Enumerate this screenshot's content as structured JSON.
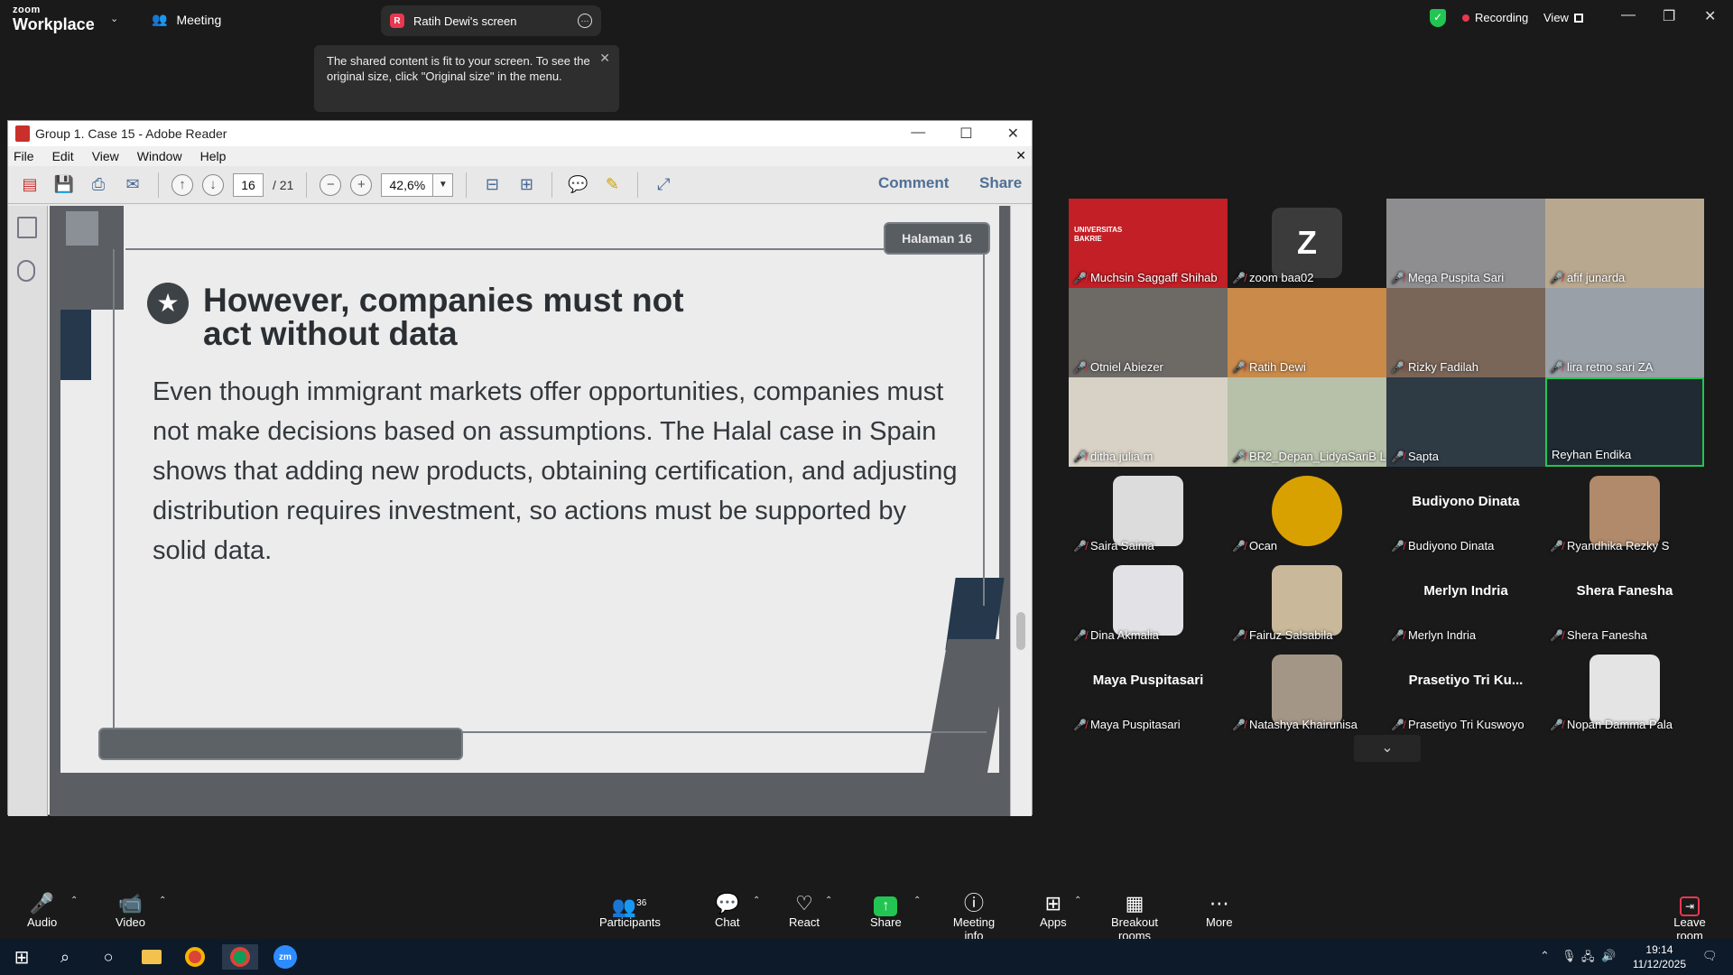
{
  "app": {
    "logo_small": "zoom",
    "logo_large": "Workplace",
    "meeting_tab": "Meeting",
    "share_tab": "Ratih Dewi's screen",
    "share_tab_initial": "R",
    "recording_label": "Recording",
    "view_label": "View",
    "tooltip": "The shared content is fit to your screen. To see the original size, click \"Original size\" in the menu."
  },
  "reader": {
    "title": "Group 1. Case 15 - Adobe Reader",
    "menu": [
      "File",
      "Edit",
      "View",
      "Window",
      "Help"
    ],
    "page_current": "16",
    "page_total": "/ 21",
    "zoom": "42,6%",
    "comment_label": "Comment",
    "share_label": "Share"
  },
  "slide": {
    "page_badge": "Halaman 16",
    "headline_line1": "However, companies must not",
    "headline_line2": "act without data",
    "body": "Even though immigrant markets offer opportunities, companies must not make decisions based on assumptions. The Halal case in Spain shows that adding new products, obtaining certification, and adjusting distribution requires investment, so actions must be supported by solid data."
  },
  "gallery": {
    "participants": [
      {
        "name": "Muchsin Saggaff Shihab",
        "label": "UNIVERSITAS BAKRIE",
        "bg": "#c21f26"
      },
      {
        "name": "zoom baa02",
        "initial": "Z",
        "bg": "#1a1a1a"
      },
      {
        "name": "Mega Puspita Sari",
        "bg": "#8e8e90"
      },
      {
        "name": "afif junarda",
        "bg": "#b9a890"
      },
      {
        "name": "Otniel Abiezer",
        "bg": "#6d6a66"
      },
      {
        "name": "Ratih Dewi",
        "bg": "#c98a4a"
      },
      {
        "name": "Rizky Fadilah",
        "bg": "#7a6658"
      },
      {
        "name": "lira retno sari ZA",
        "bg": "#9aa0a8"
      },
      {
        "name": "ditha julia m",
        "bg": "#d8d2c6"
      },
      {
        "name": "BR2_Depan_LidyaSariB L...",
        "bg": "#b7c0a8"
      },
      {
        "name": "Sapta",
        "bg": "#2e3a44"
      },
      {
        "name": "Reyhan Endika",
        "bg": "#1f2a33"
      },
      {
        "name": "Saira Saima",
        "bg": "#dcdcdc"
      },
      {
        "name": "Ocan",
        "bg": "#d9a100"
      },
      {
        "name": "Budiyono Dinata",
        "big": "Budiyono Dinata"
      },
      {
        "name": "Ryandhika Rezky S",
        "bg": "#b08a6a"
      },
      {
        "name": "Dina Akmalia",
        "bg": "#e2e2e6"
      },
      {
        "name": "Fairuz Salsabila",
        "bg": "#c9b89a"
      },
      {
        "name": "Merlyn Indria",
        "big": "Merlyn Indria"
      },
      {
        "name": "Shera Fanesha",
        "big": "Shera Fanesha"
      },
      {
        "name": "Maya Puspitasari",
        "big": "Maya Puspitasari"
      },
      {
        "name": "Natashya Khairunisa",
        "bg": "#a49686"
      },
      {
        "name": "Prasetiyo Tri Kuswoyo",
        "big": "Prasetiyo Tri Ku..."
      },
      {
        "name": "Nopan Damma Pala",
        "bg": "#e4e4e4"
      }
    ]
  },
  "toolbar": {
    "audio": "Audio",
    "video": "Video",
    "participants": "Participants",
    "participants_count": "36",
    "chat": "Chat",
    "react": "React",
    "share": "Share",
    "meeting_info": "Meeting info",
    "apps": "Apps",
    "breakout": "Breakout rooms",
    "more": "More",
    "leave": "Leave room"
  },
  "taskbar": {
    "time": "19:14",
    "date": "11/12/2025"
  }
}
